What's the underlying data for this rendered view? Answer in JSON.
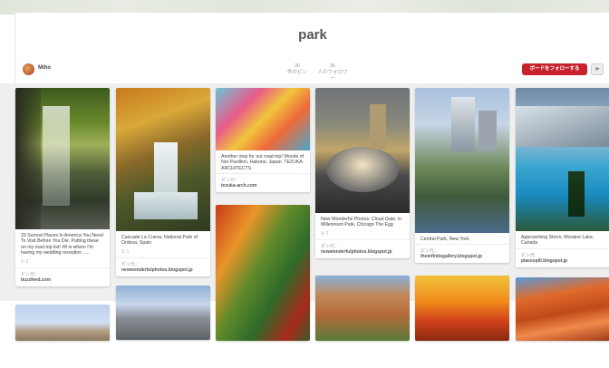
{
  "board": {
    "title": "park"
  },
  "owner": {
    "name": "Miho"
  },
  "stats": [
    {
      "num": "30",
      "label": "件のピン"
    },
    {
      "num": "36",
      "label": "人のフォロワー"
    }
  ],
  "actions": {
    "follow_label": "ボードをフォローする",
    "send_icon": "➤"
  },
  "colors": {
    "follow": "#c8232c"
  },
  "pins": [
    {
      "desc": "29 Surreal Places In America You Need To Visit Before You Die. Putting these on my road trip list! #8 is where I'm having my wedding reception .....",
      "repins": "2",
      "source_label": "ピン元：",
      "source": "buzzfeed.com"
    },
    {
      "desc": "Cascade La Cueva, National Park of Ordesa, Spain",
      "repins": "1",
      "source_label": "ピン元：",
      "source": "newwonderfulphotos.blogspot.jp"
    },
    {
      "desc": "Another stop for our road trip! Woods of Net Pavillion, Hakone, Japan. TEZUKA ARCHITECTS",
      "repins": "",
      "source_label": "ピン元：",
      "source": "tezuka-arch.com"
    },
    {
      "desc": "New Wonderful Photos: Cloud Gate, in Millennium Park, Chicago The Egg",
      "repins": "1",
      "source_label": "ピン元：",
      "source": "newwonderfulphotos.blogspot.jp"
    },
    {
      "desc": "Central Park, New York",
      "repins": "",
      "source_label": "ピン元：",
      "source": "theinfinitegallery.blogspot.jp"
    },
    {
      "desc": "Approaching Storm, Moraine Lake, Canada",
      "repins": "",
      "source_label": "ピン元：",
      "source": "placespill.blogspot.jp"
    }
  ]
}
